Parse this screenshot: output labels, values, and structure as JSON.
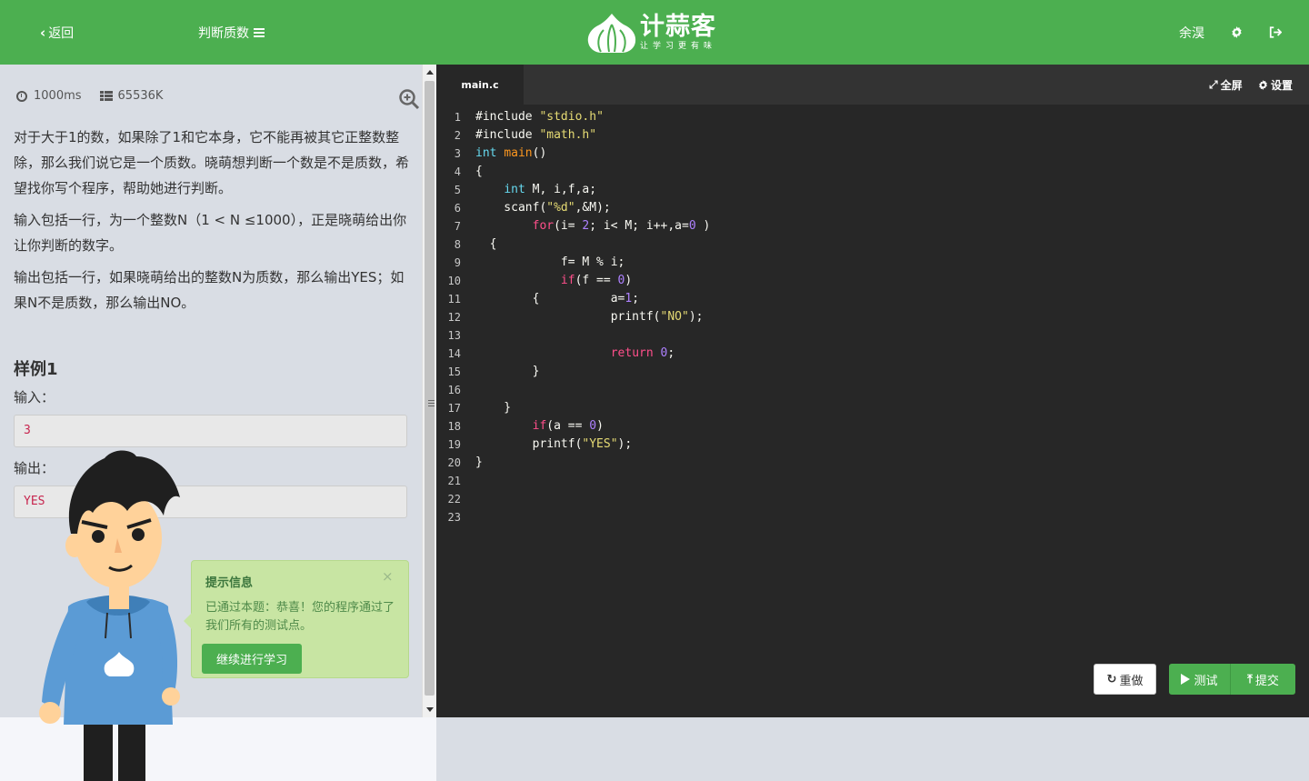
{
  "header": {
    "back_label": "返回",
    "problem_label": "判断质数",
    "brand_name": "计蒜客",
    "brand_slogan": "让学习更有味",
    "username": "余淏",
    "icons": [
      "chevron-left-icon",
      "menu-icon",
      "gear-icon",
      "logout-icon"
    ]
  },
  "problem": {
    "time_limit": "1000ms",
    "memory_limit": "65536K",
    "paragraphs": [
      "对于大于1的数，如果除了1和它本身，它不能再被其它正整数整除，那么我们说它是一个质数。晓萌想判断一个数是不是质数，希望找你写个程序，帮助她进行判断。",
      "输入包括一行，为一个整数N（1 < N ≤1000），正是晓萌给出你让你判断的数字。",
      "输出包括一行，如果晓萌给出的整数N为质数，那么输出YES；如果N不是质数，那么输出NO。"
    ],
    "sample_title": "样例1",
    "input_label": "输入：",
    "input_value": "3",
    "output_label": "输出：",
    "output_value": "YES"
  },
  "tip": {
    "title": "提示信息",
    "close": "×",
    "message": "已通过本题：恭喜！您的程序通过了我们所有的测试点。",
    "button": "继续进行学习"
  },
  "editor": {
    "tab": "main.c",
    "fullscreen_label": "全屏",
    "settings_label": "设置",
    "lines": [
      "#include \"stdio.h\"",
      "#include \"math.h\"",
      "int main()",
      "{",
      "    int M, i,f,a;",
      "    scanf(\"%d\",&M);",
      "        for(i= 2; i< M; i++,a=0 )",
      "  {",
      "            f= M % i;",
      "            if(f == 0)",
      "        {          a=1;",
      "                   printf(\"NO\");",
      "",
      "                   return 0;",
      "        }",
      "",
      "    }",
      "        if(a == 0)",
      "        printf(\"YES\");",
      "}",
      "",
      "",
      ""
    ],
    "reset_label": "重做",
    "test_label": "测试",
    "submit_label": "提交"
  },
  "colors": {
    "brand_green": "#4caf50",
    "editor_bg": "#272727",
    "tip_bg": "#c8e5a3"
  }
}
